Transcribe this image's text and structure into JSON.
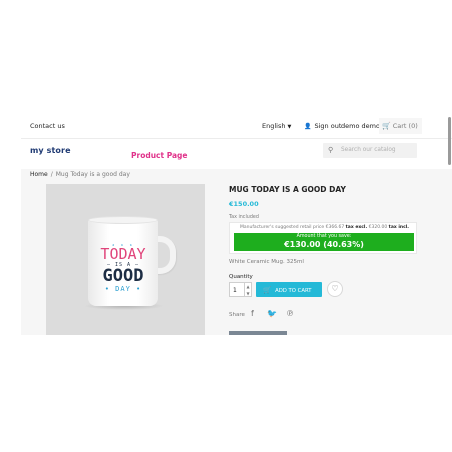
{
  "topnav": {
    "contact": "Contact us",
    "language": "English",
    "sign_out": "Sign out",
    "user": "demo demo",
    "cart": "Cart (0)"
  },
  "header": {
    "logo_main": "my store",
    "badge": "Product Page",
    "search_placeholder": "Search our catalog"
  },
  "breadcrumb": {
    "home": "Home",
    "separator": "/",
    "current": "Mug Today is a good day"
  },
  "mug_print": {
    "today": "TODAY",
    "is_a": "— IS A —",
    "good": "GOOD",
    "day": "• DAY •",
    "stars": "★ ★ ★"
  },
  "product": {
    "title": "MUG TODAY IS A GOOD DAY",
    "price": "€150.00",
    "tax_label": "Tax included",
    "msrp_prefix": "Manufacturer's suggested retail price €366.67",
    "msrp_tax_excl": "tax excl.",
    "msrp_mid": " €320.00",
    "msrp_tax_incl": "tax incl.",
    "save_label": "Amount that you save:",
    "save_amount": "€130.00 (40.63%)",
    "description": "White Ceramic Mug. 325ml",
    "quantity_label": "Quantity",
    "quantity_value": "1",
    "add_to_cart": "ADD TO CART",
    "share_label": "Share"
  },
  "colors": {
    "accent": "#24b9d7",
    "save_green": "#1eae1e",
    "badge_pink": "#e0328a"
  },
  "icons": {
    "user": "user-icon",
    "cart": "cart-icon",
    "search": "search-icon",
    "wishlist": "heart-icon",
    "facebook": "facebook-icon",
    "twitter": "twitter-icon",
    "pinterest": "pinterest-icon"
  }
}
